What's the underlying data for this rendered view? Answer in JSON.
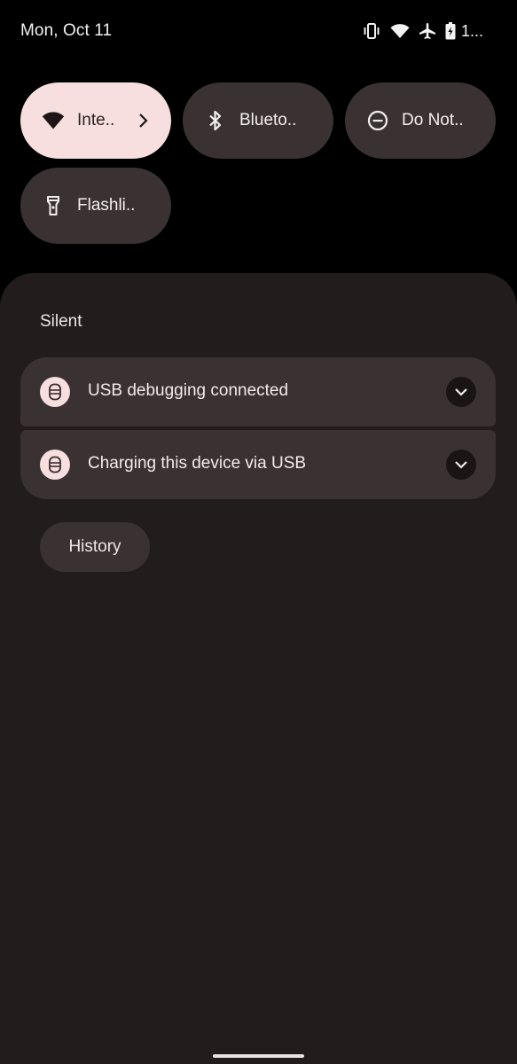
{
  "status_bar": {
    "date": "Mon, Oct 11",
    "battery_text": "1...",
    "icons": [
      "vibrate-icon",
      "wifi-icon",
      "airplane-icon",
      "battery-charging-icon"
    ]
  },
  "quick_settings": {
    "tiles": [
      {
        "label": "Inte..",
        "icon": "wifi-icon",
        "active": true,
        "has_chevron": true
      },
      {
        "label": "Blueto..",
        "icon": "bluetooth-icon",
        "active": false
      },
      {
        "label": "Do Not..",
        "icon": "do-not-disturb-icon",
        "active": false
      },
      {
        "label": "Flashli..",
        "icon": "flashlight-icon",
        "active": false
      }
    ]
  },
  "notifications": {
    "section_title": "Silent",
    "items": [
      {
        "title": "USB debugging connected",
        "icon": "usb-icon"
      },
      {
        "title": "Charging this device via USB",
        "icon": "usb-icon"
      }
    ],
    "history_label": "History"
  },
  "colors": {
    "background": "#000000",
    "shade": "#231c1c",
    "card": "#3a3232",
    "accent": "#f7dfe0"
  }
}
